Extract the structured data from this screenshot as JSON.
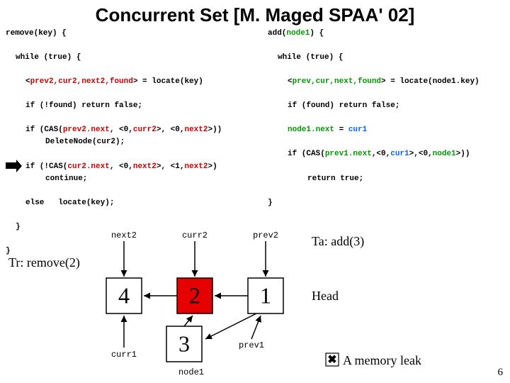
{
  "title": "Concurrent Set [M. Maged SPAA' 02]",
  "left": {
    "l1": "remove(key) {",
    "l2": "while (true) {",
    "l3a": "<",
    "l3b": "prev2,cur2,next2,found",
    "l3c": "> = locate(key)",
    "l4": "if (!found) return false;",
    "l5a": "if (CAS(",
    "l5b": "prev2.next",
    "l5c": ", <0,",
    "l5d": "curr2",
    "l5e": ">, <0,",
    "l5f": "next2",
    "l5g": ">))",
    "l6": "DeleteNode(cur2);",
    "l7a": "if (!CAS(",
    "l7b": "cur2.next",
    "l7c": ", <0,",
    "l7d": "next2",
    "l7e": ">, <1,",
    "l7f": "next2",
    "l7g": ">)",
    "l8": "continue;",
    "l9a": "else",
    "l9b": "locate(key);",
    "l10": "}",
    "l11": "}"
  },
  "right": {
    "l1a": "add(",
    "l1b": "node1",
    "l1c": ") {",
    "l2": "while (true) {",
    "l3a": "<",
    "l3b": "prev,cur,next,found",
    "l3c": "> = locate(node1.key)",
    "l4": "if (found) return false;",
    "l5a": "node1.next",
    "l5b": " = ",
    "l5c": "cur1",
    "l6a": "if (CAS(",
    "l6b": "prev1.next",
    "l6c": ",<0,",
    "l6d": "cur1",
    "l6e": ">,<0,",
    "l6f": "node1",
    "l6g": ">))",
    "l7": "return true;",
    "l8": "}"
  },
  "threads": {
    "remove": "Tr: remove(2)",
    "add": "Ta: add(3)"
  },
  "diagram": {
    "labels": {
      "next2": "next2",
      "curr2": "curr2",
      "prev2": "prev2",
      "curr1": "curr1",
      "prev1": "prev1",
      "node1": "node1",
      "head": "Head",
      "leak": "A memory leak"
    },
    "nodes": {
      "a": "4",
      "b": "2",
      "c": "1",
      "d": "3"
    }
  },
  "page": "6"
}
